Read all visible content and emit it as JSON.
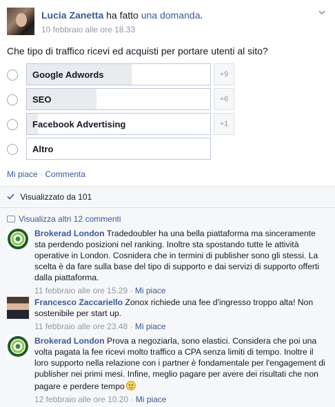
{
  "post": {
    "author": "Lucia Zanetta",
    "action_prefix": " ha fatto ",
    "action_link": "una domanda",
    "action_suffix": ".",
    "timestamp": "10 febbraio alle ore 18.33",
    "menu_icon": "chevron-down-icon",
    "question": "Che tipo di traffico ricevi ed acquisti per portare utenti al sito?"
  },
  "poll": {
    "options": [
      {
        "label": "Google Adwords",
        "votes": "+9",
        "fill_fraction": 0.57
      },
      {
        "label": "SEO",
        "votes": "+6",
        "fill_fraction": 0.38
      },
      {
        "label": "Facebook Advertising",
        "votes": "+1",
        "fill_fraction": 0.06
      },
      {
        "label": "Altro",
        "votes": "",
        "fill_fraction": 0.0
      }
    ]
  },
  "post_actions": {
    "like": "Mi piace",
    "separator": " · ",
    "comment": "Commenta"
  },
  "ufi": {
    "seen_text": "Visualizzato da 101",
    "more_comments": "Visualizza altri 12 commenti"
  },
  "comments": [
    {
      "author": "Brokerad London",
      "text": "Tradedoubler ha una bella piattaforma ma sinceramente sta perdendo posizioni nel ranking. Inoltre sta spostando tutte le attività operative in London. Cosnidera che in termini di publisher sono gli stessi. La scelta è da fare sulla base del tipo di supporto e dai servizi di supporto offerti dalla piattaforma.",
      "time": "11 febbraio alle ore 15.29",
      "like": "Mi piace"
    },
    {
      "author": "Francesco Zaccariello",
      "text": "Zonox richiede una fee d'ingresso troppo alta! Non sostenibile per start up.",
      "time": "11 febbraio alle ore 23.48",
      "like": "Mi piace"
    },
    {
      "author": "Brokerad London",
      "text": "Prova a negoziarla, sono elastici. Considera che poi una volta pagata la fee ricevi molto traffico a CPA senza limiti di tempo. Inoltre il loro supporto nella relazione con i partner è fondamentale per l'engagement di publisher nei primi mesi. Infine, meglio pagare per avere dei risultati che non pagare e perdere tempo",
      "time": "12 febbraio alle ore 10.20",
      "like": "Mi piace"
    }
  ],
  "meta_separator": " · "
}
